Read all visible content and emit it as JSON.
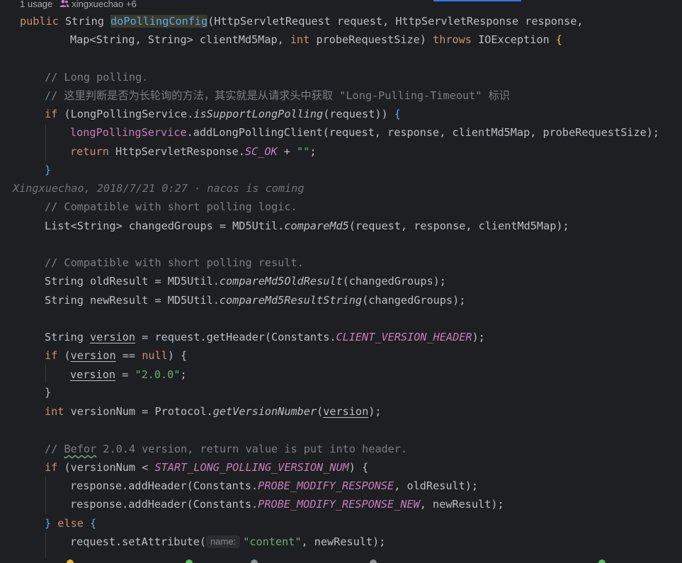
{
  "hints": {
    "usages": "1 usage",
    "authors": "xingxuechao +6"
  },
  "blame": {
    "text": "Xingxuechao, 2018/7/21 0:27 · nacos is coming"
  },
  "code": {
    "l1": {
      "kw1": "public ",
      "t1": "String ",
      "fn": "doPollingConfig",
      "t2": "(HttpServletRequest request, HttpServletResponse response,"
    },
    "l2": {
      "t1": "Map",
      "t2": "<String, String> clientMd5Map, ",
      "kw1": "int ",
      "t3": "probeRequestSize) ",
      "kw2": "throws ",
      "t4": "IOException ",
      "t5": "{"
    },
    "l3": {
      "cm": "// Long polling."
    },
    "l4": {
      "cm": "// 这里判断是否为长轮询的方法，其实就是从请求头中获取 \"Long-Pulling-Timeout\" 标识"
    },
    "l5": {
      "kw1": "if ",
      "t1": "(LongPollingService.",
      "m1": "isSupportLongPolling",
      "t2": "(request)) ",
      "t3": "{"
    },
    "l6": {
      "f1": "longPollingService",
      "t1": ".addLongPollingClient(request, response, clientMd5Map, probeRequestSize);"
    },
    "l7": {
      "kw1": "return ",
      "t1": "HttpServletResponse.",
      "s1": "SC_OK",
      "t2": " + ",
      "st": "\"\"",
      "t3": ";"
    },
    "l8": {
      "t1": "}"
    },
    "l9": {
      "cm": "// Compatible with short polling logic."
    },
    "l10": {
      "t1": "List<String> changedGroups = MD5Util.",
      "m1": "compareMd5",
      "t2": "(request, response, clientMd5Map);"
    },
    "l11": {
      "cm": "// Compatible with short polling result."
    },
    "l12": {
      "t1": "String oldResult = MD5Util.",
      "m1": "compareMd5OldResult",
      "t2": "(changedGroups);"
    },
    "l13": {
      "t1": "String newResult = MD5Util.",
      "m1": "compareMd5ResultString",
      "t2": "(changedGroups);"
    },
    "l14": {
      "t1": "String ",
      "u1": "version",
      "t2": " = request.getHeader(Constants.",
      "s1": "CLIENT_VERSION_HEADER",
      "t3": ");"
    },
    "l15": {
      "kw1": "if ",
      "t1": "(",
      "u1": "version",
      "t2": " == ",
      "kw2": "null",
      "t3": ") {"
    },
    "l16": {
      "u1": "version",
      "t1": " = ",
      "st": "\"2.0.0\"",
      "t2": ";"
    },
    "l17": {
      "t1": "}"
    },
    "l18": {
      "kw1": "int ",
      "t1": "versionNum = Protocol.",
      "m1": "getVersionNumber",
      "t2": "(",
      "u1": "version",
      "t3": ");"
    },
    "l19": {
      "cm1": "// ",
      "cm2": "Befor",
      "cm3": " 2.0.4 version, return value is put into header."
    },
    "l20": {
      "kw1": "if ",
      "t1": "(versionNum < ",
      "s1": "START_LONG_POLLING_VERSION_NUM",
      "t2": ") {"
    },
    "l21": {
      "t1": "response.addHeader(Constants.",
      "s1": "PROBE_MODIFY_RESPONSE",
      "t2": ", oldResult);"
    },
    "l22": {
      "t1": "response.addHeader(Constants.",
      "s1": "PROBE_MODIFY_RESPONSE_NEW",
      "t2": ", newResult);"
    },
    "l23": {
      "t1": "} ",
      "kw1": "else ",
      "t2": "{"
    },
    "l24": {
      "t1": "request.setAttribute(",
      "hint": "name:",
      "st": "\"content\"",
      "t2": ", newResult);"
    }
  },
  "colors": {
    "background": "#1e1f22",
    "keyword": "#cf8e6d",
    "method_decl": "#56a8f5",
    "comment": "#7a7e85",
    "string": "#6aab73",
    "field": "#c77dbb",
    "text": "#bcbec4"
  },
  "icons": [
    "people-icon"
  ]
}
